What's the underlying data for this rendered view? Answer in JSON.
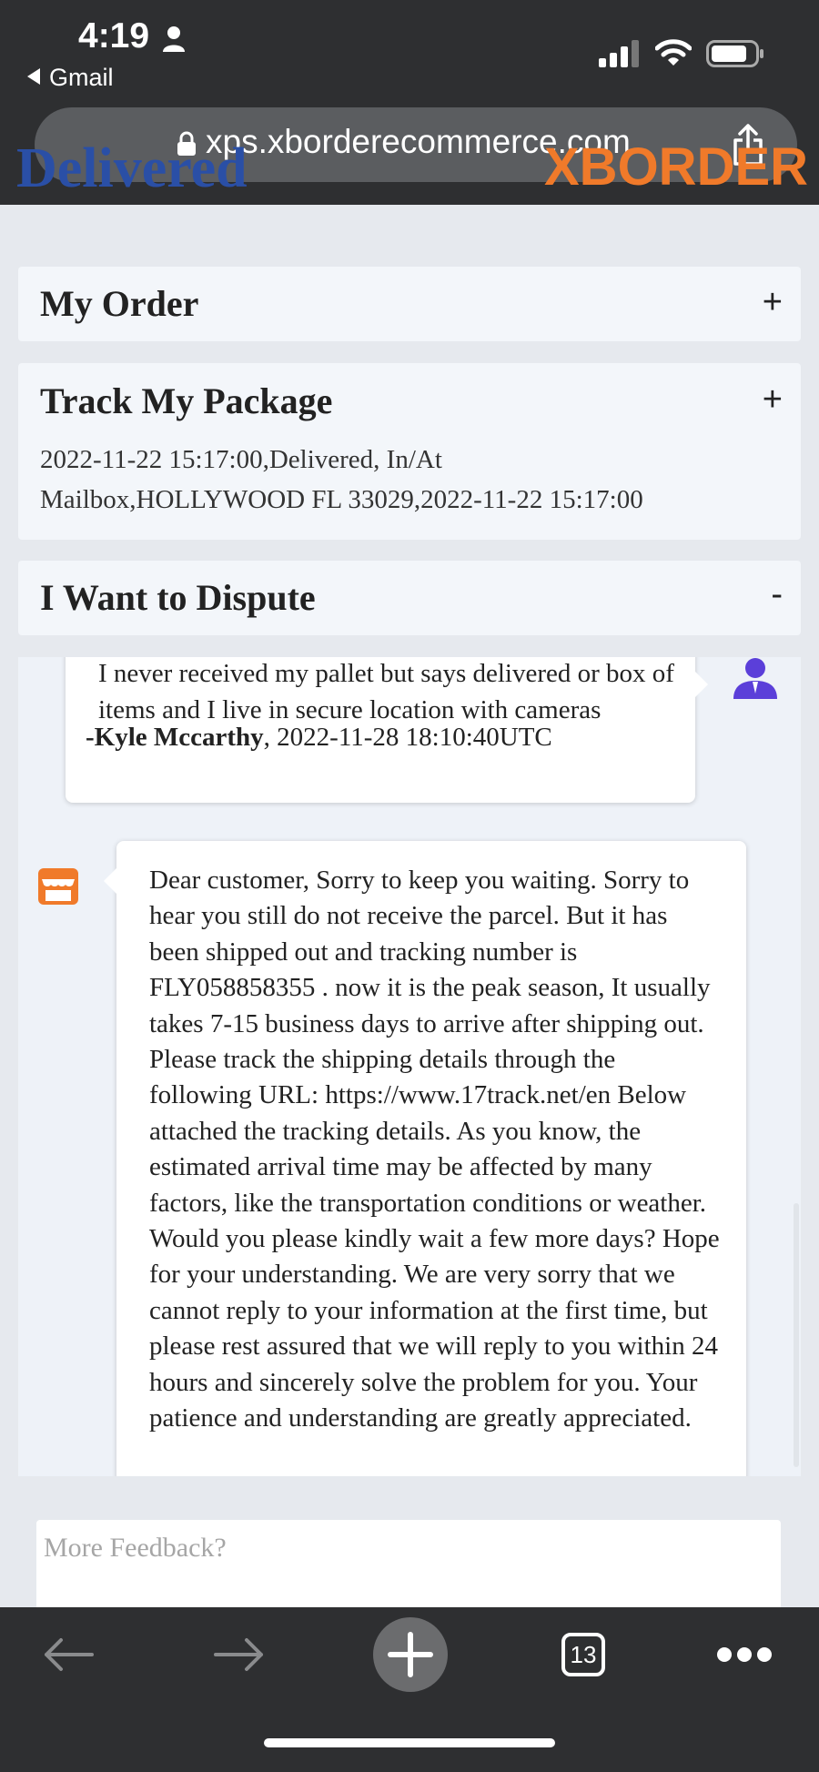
{
  "status_bar": {
    "time": "4:19",
    "back_app": "Gmail"
  },
  "browser": {
    "url": "xps.xborderecommerce.com",
    "tabs_count": "13"
  },
  "page": {
    "peek_left": "Delivered",
    "peek_right": "XBORDER",
    "my_order": {
      "title": "My Order",
      "toggle": "+"
    },
    "track_package": {
      "title": "Track My Package",
      "toggle": "+",
      "line1": "2022-11-22 15:17:00,Delivered, In/At",
      "line2": "Mailbox,HOLLYWOOD FL 33029,2022-11-22 15:17:00"
    },
    "dispute": {
      "title": "I Want to Dispute",
      "toggle": "-"
    }
  },
  "messages": {
    "customer": {
      "text": "I never received my pallet but says delivered or box of items and I live in secure location with cameras",
      "author": "-Kyle Mccarthy",
      "timestamp": ", 2022-11-28 18:10:40UTC"
    },
    "seller": {
      "text": "Dear customer, Sorry to keep you waiting. Sorry to hear you still do not receive the parcel. But it has been shipped out and tracking number is FLY058858355 . now it is the peak season,   It usually takes 7-15 business days to arrive after shipping out. Please track the shipping details through the following URL: https://www.17track.net/en Below attached the tracking details. As you know, the estimated arrival time may be affected by many factors, like the transportation conditions or weather. Would you please kindly wait a few more days? Hope for your understanding. We are very sorry that we cannot reply to your information at the first time, but please rest assured that we will reply to you within 24 hours and sincerely solve the problem for you. Your patience and understanding are greatly appreciated."
    }
  },
  "feedback": {
    "placeholder": "More Feedback?"
  },
  "colors": {
    "brand_blue": "#2a4fa6",
    "brand_orange": "#f07a2a",
    "avatar_purple": "#5b3fd9",
    "store_orange": "#f07a2a"
  }
}
